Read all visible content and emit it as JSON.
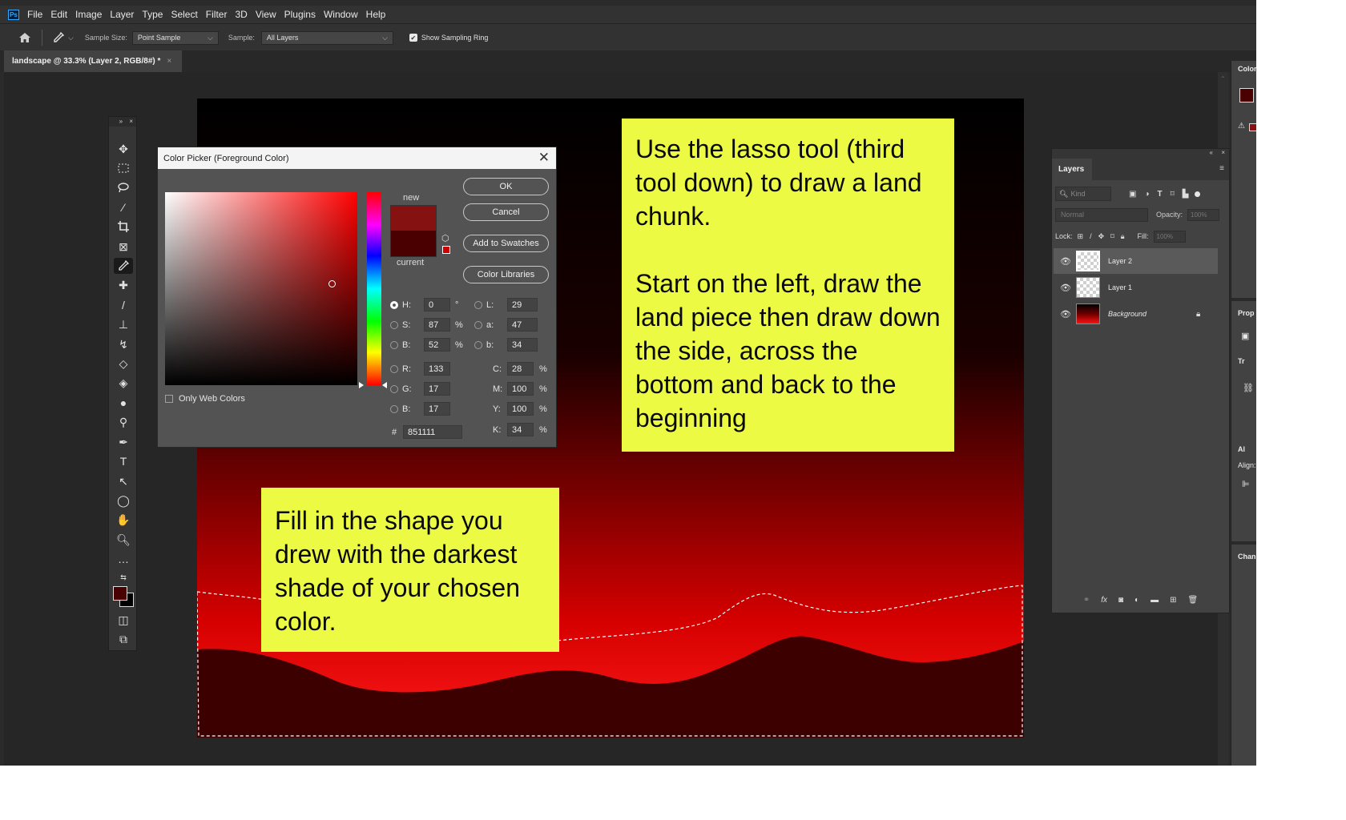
{
  "app": {
    "logo": "Ps"
  },
  "menu": [
    "File",
    "Edit",
    "Image",
    "Layer",
    "Type",
    "Select",
    "Filter",
    "3D",
    "View",
    "Plugins",
    "Window",
    "Help"
  ],
  "options_bar": {
    "home_icon": "home-icon",
    "tool_icon": "eyedropper-icon",
    "sample_size_label": "Sample Size:",
    "sample_size_value": "Point Sample",
    "sample_label": "Sample:",
    "sample_value": "All Layers",
    "show_sampling_ring_label": "Show Sampling Ring",
    "show_sampling_ring_checked": true
  },
  "document_tab": {
    "title": "landscape @ 33.3% (Layer 2, RGB/8#) *",
    "close": "×"
  },
  "toolbar": {
    "collapse": "»",
    "close": "×"
  },
  "color_picker": {
    "title": "Color Picker (Foreground Color)",
    "new_label": "new",
    "current_label": "current",
    "new_color": "#851111",
    "current_color": "#4a0000",
    "buttons": {
      "ok": "OK",
      "cancel": "Cancel",
      "add_swatches": "Add to Swatches",
      "color_libraries": "Color Libraries"
    },
    "only_web_colors": "Only Web Colors",
    "hsb": {
      "h_label": "H:",
      "h": "0",
      "h_unit": "°",
      "s_label": "S:",
      "s": "87",
      "s_unit": "%",
      "b_label": "B:",
      "b": "52",
      "b_unit": "%"
    },
    "lab": {
      "l_label": "L:",
      "l": "29",
      "a_label": "a:",
      "a": "47",
      "b_label": "b:",
      "b": "34"
    },
    "rgb": {
      "r_label": "R:",
      "r": "133",
      "g_label": "G:",
      "g": "17",
      "b_label": "B:",
      "b": "17"
    },
    "cmyk": {
      "c_label": "C:",
      "c": "28",
      "m_label": "M:",
      "m": "100",
      "y_label": "Y:",
      "y": "100",
      "k_label": "K:",
      "k": "34",
      "unit": "%"
    },
    "hex_label": "#",
    "hex": "851111"
  },
  "notes": {
    "lasso": "Use the lasso tool (third tool down) to draw a land chunk.\n\nStart on the left, draw the land piece then draw down the side, across the bottom and back to the beginning",
    "fill": "Fill in the shape you drew with the darkest shade of your chosen color."
  },
  "layers_panel": {
    "tab": "Layers",
    "kind_placeholder": "Kind",
    "blend_mode": "Normal",
    "opacity_label": "Opacity:",
    "opacity_value": "100%",
    "lock_label": "Lock:",
    "fill_label": "Fill:",
    "fill_value": "100%",
    "layers": [
      {
        "name": "Layer 2",
        "selected": true
      },
      {
        "name": "Layer 1",
        "selected": false
      },
      {
        "name": "Background",
        "selected": false,
        "locked": true
      }
    ]
  },
  "right_strip": {
    "color_tab": "Color",
    "properties_tab": "Prop",
    "transform_label": "Tr",
    "align_label": "Al",
    "align_text": "Align:",
    "channels_tab": "Chan"
  }
}
